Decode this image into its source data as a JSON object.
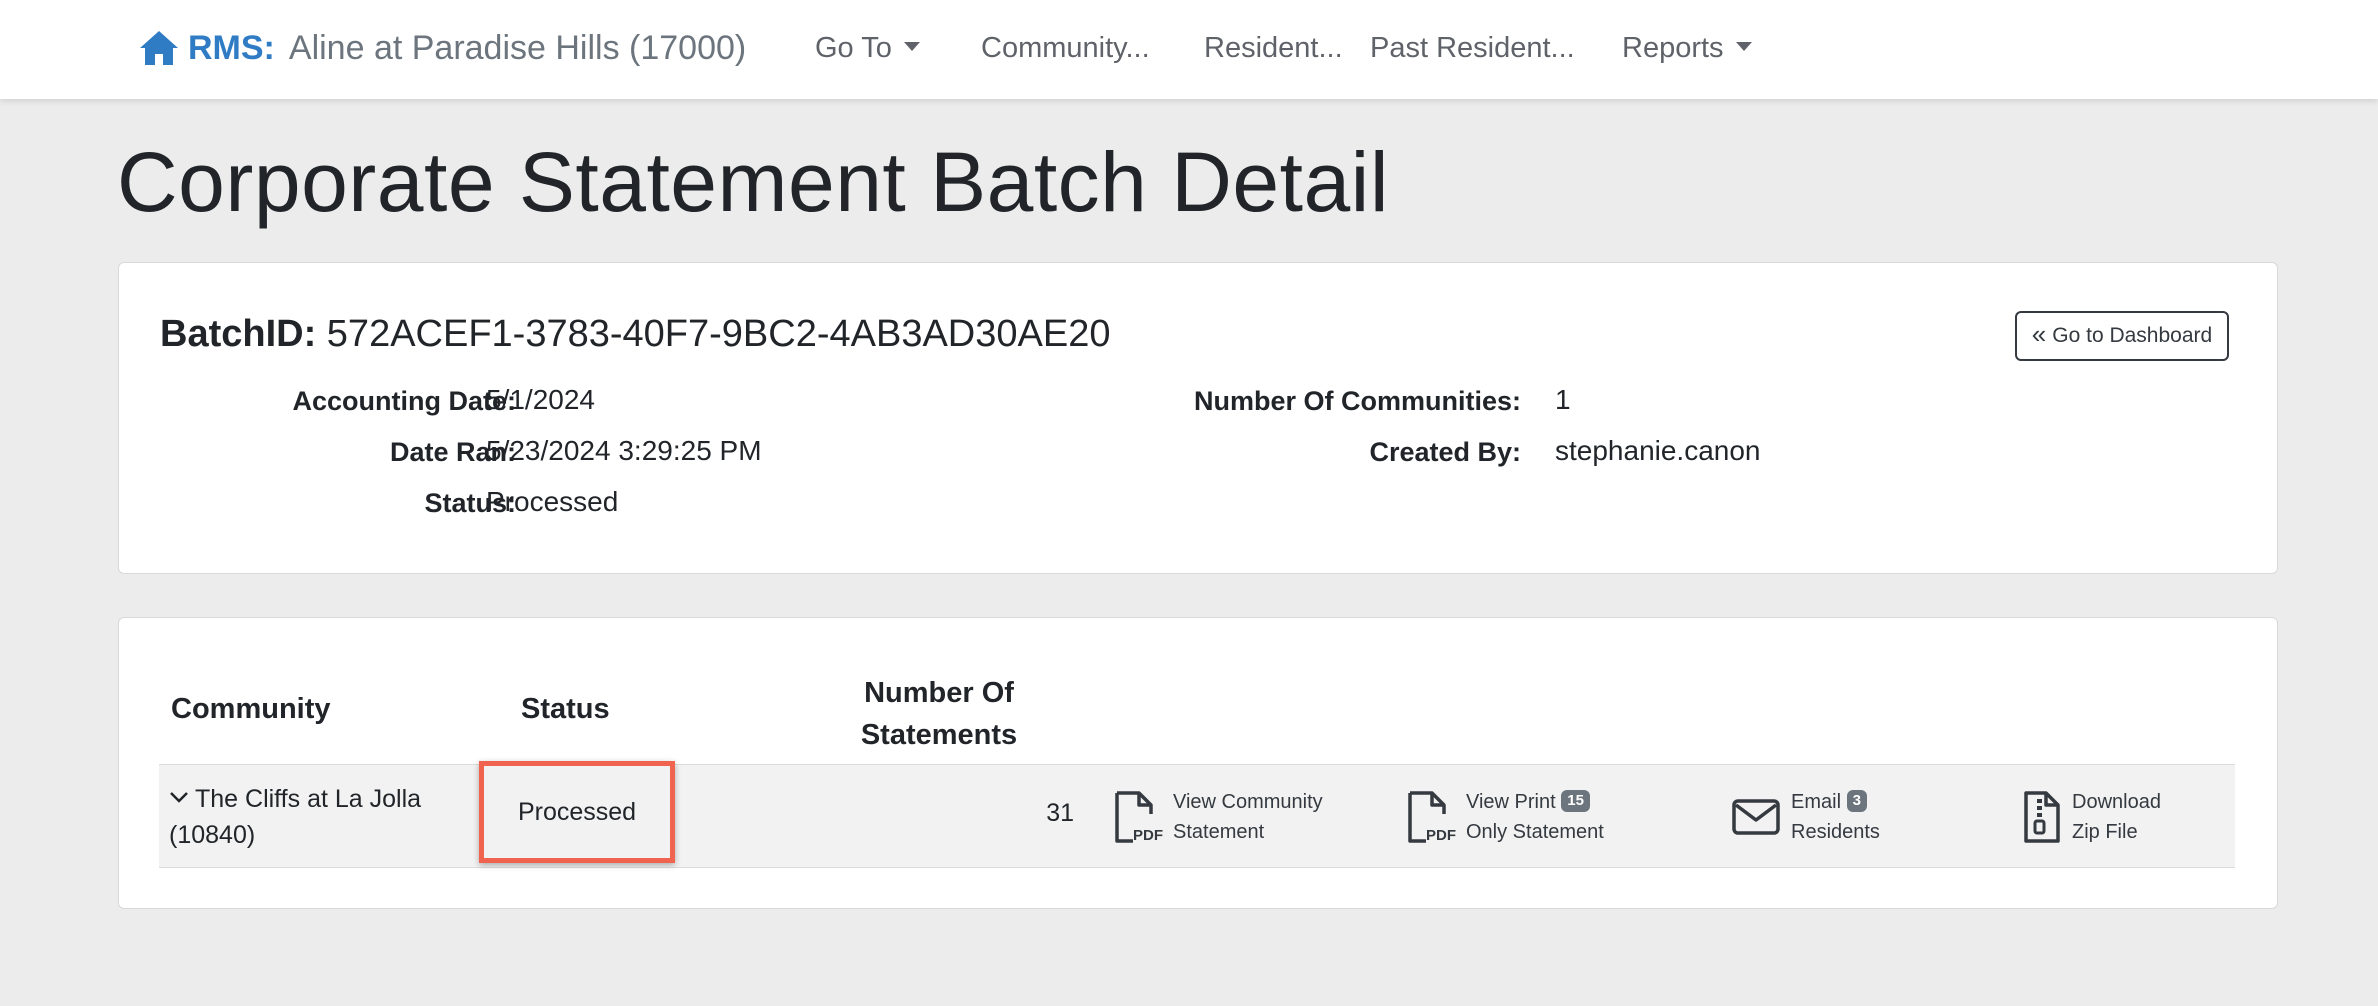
{
  "navbar": {
    "brand_label": "RMS:",
    "community_name": "Aline at Paradise Hills (17000)",
    "items": [
      {
        "label": "Go To"
      },
      {
        "label": "Community..."
      },
      {
        "label": "Resident..."
      },
      {
        "label": "Past Resident..."
      },
      {
        "label": "Reports"
      }
    ]
  },
  "page": {
    "title": "Corporate Statement Batch Detail"
  },
  "summary": {
    "batch_label": "BatchID:",
    "batch_id": "572ACEF1-3783-40F7-9BC2-4AB3AD30AE20",
    "dashboard_button": "Go to Dashboard",
    "accounting_date_label": "Accounting Date:",
    "accounting_date": "5/1/2024",
    "date_ran_label": "Date Ran:",
    "date_ran": "5/23/2024 3:29:25 PM",
    "status_label": "Status:",
    "status": "Processed",
    "num_communities_label": "Number Of Communities:",
    "num_communities": "1",
    "created_by_label": "Created By:",
    "created_by": "stephanie.canon"
  },
  "table": {
    "headers": {
      "community": "Community",
      "status": "Status",
      "num_statements_line1": "Number Of",
      "num_statements_line2": "Statements"
    },
    "rows": [
      {
        "community_line1": "The Cliffs at La Jolla",
        "community_line2": "(10840)",
        "status": "Processed",
        "num_statements": "31",
        "actions": {
          "view_community_line1": "View Community",
          "view_community_line2": "Statement",
          "view_print_line1": "View Print",
          "view_print_badge": "15",
          "view_print_line2": "Only Statement",
          "email_line1": "Email",
          "email_badge": "3",
          "email_line2": "Residents",
          "download_line1": "Download",
          "download_line2": "Zip File"
        }
      }
    ]
  },
  "colors": {
    "brand_blue": "#2f7cc5",
    "highlight_border": "#f0644f",
    "badge_gray": "#6c757d"
  }
}
